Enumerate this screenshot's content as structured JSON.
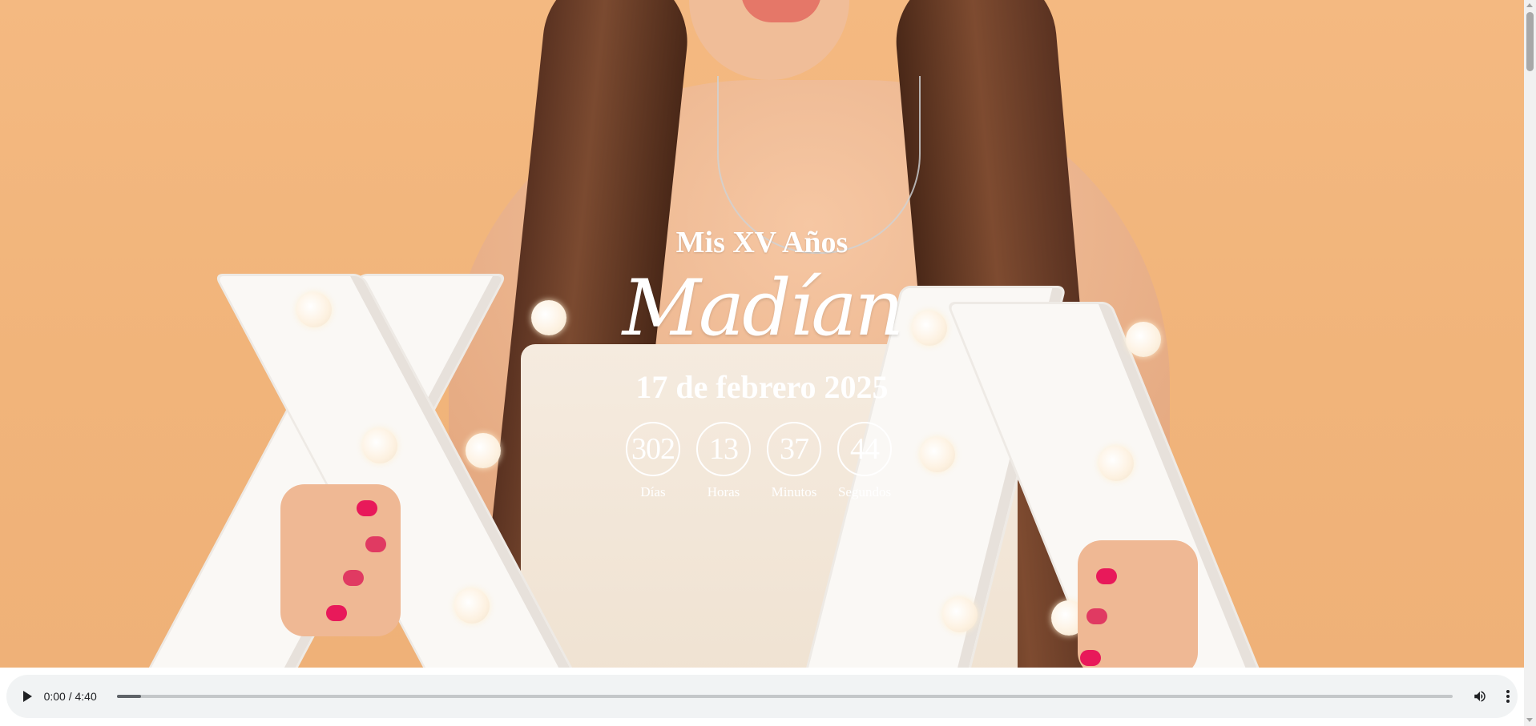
{
  "hero": {
    "subtitle": "Mis XV Años",
    "name": "Madían",
    "date": "17 de febrero 2025",
    "background_color": "#f2b57c"
  },
  "countdown": [
    {
      "value": "302",
      "label": "Días"
    },
    {
      "value": "13",
      "label": "Horas"
    },
    {
      "value": "37",
      "label": "Minutos"
    },
    {
      "value": "44",
      "label": "Segundos"
    }
  ],
  "audio": {
    "time": "0:00 / 4:40",
    "buffered_fraction": 0.018,
    "play_icon": "play-icon",
    "volume_icon": "volume-icon",
    "menu_icon": "more-vertical-icon"
  }
}
